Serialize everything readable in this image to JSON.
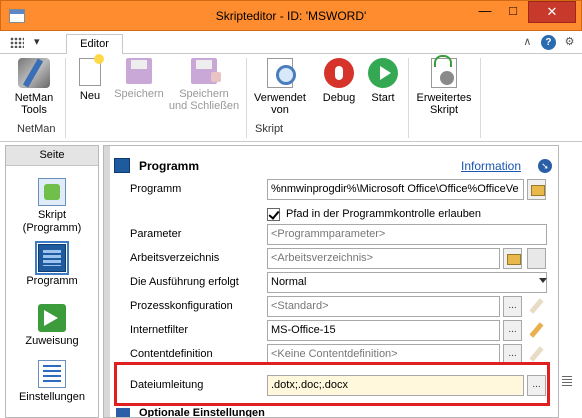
{
  "window": {
    "title": "Skripteditor - ID: 'MSWORD'",
    "min_glyph": "—",
    "max_glyph": "□",
    "close_glyph": "✕"
  },
  "ribbon": {
    "app_menu_arrow": "▾",
    "active_tab": "Editor",
    "tab_icons": {
      "collapse": "∧",
      "help": "?",
      "gear": "⚙"
    },
    "groups": {
      "netman": {
        "name": "NetMan",
        "buttons": {
          "tools": {
            "label_line1": "NetMan",
            "label_line2": "Tools"
          }
        }
      },
      "skript": {
        "name": "Skript",
        "buttons": {
          "neu": {
            "label": "Neu"
          },
          "speichern": {
            "label": "Speichern"
          },
          "speichern_schliessen": {
            "label_line1": "Speichern",
            "label_line2": "und Schließen"
          },
          "verwendet_von": {
            "label_line1": "Verwendet",
            "label_line2": "von"
          },
          "debug": {
            "label": "Debug"
          },
          "start": {
            "label": "Start"
          },
          "erweitertes_skript": {
            "label_line1": "Erweitertes",
            "label_line2": "Skript"
          }
        }
      }
    }
  },
  "sidebar": {
    "header": "Seite",
    "items": [
      {
        "label_line1": "Skript",
        "label_line2": "(Programm)"
      },
      {
        "label_line1": "Programm",
        "label_line2": ""
      },
      {
        "label_line1": "Zuweisung",
        "label_line2": ""
      },
      {
        "label_line1": "Einstellungen",
        "label_line2": ""
      }
    ],
    "selected": "Programm"
  },
  "section": {
    "title": "Programm",
    "info_link": "Information",
    "expand_glyph": "➘"
  },
  "form": {
    "programm": {
      "label": "Programm",
      "value": "%nmwinprogdir%\\Microsoft Office\\Office%OfficeVe"
    },
    "pfad_checkbox": {
      "label": "Pfad in der Programmkontrolle erlauben",
      "checked": true
    },
    "parameter": {
      "label": "Parameter",
      "placeholder": "<Programmparameter>"
    },
    "arbeitsverzeichnis": {
      "label": "Arbeitsverzeichnis",
      "placeholder": "<Arbeitsverzeichnis>"
    },
    "ausfuehrung": {
      "label": "Die Ausführung erfolgt",
      "value": "Normal"
    },
    "prozesskonfiguration": {
      "label": "Prozesskonfiguration",
      "placeholder": "<Standard>"
    },
    "internetfilter": {
      "label": "Internetfilter",
      "value": "MS-Office-15"
    },
    "contentdefinition": {
      "label": "Contentdefinition",
      "placeholder": "<Keine Contentdefinition>"
    },
    "dateiumleitung": {
      "label": "Dateiumleitung",
      "value": ".dotx;.doc;.docx"
    },
    "ellipsis_label": "..."
  },
  "optional_section": {
    "title": "Optionale Einstellungen"
  },
  "colors": {
    "titlebar": "#ff8c2f",
    "highlight_border": "#e02020",
    "link": "#1a55b0",
    "field_highlight_bg": "#fff8dc"
  }
}
